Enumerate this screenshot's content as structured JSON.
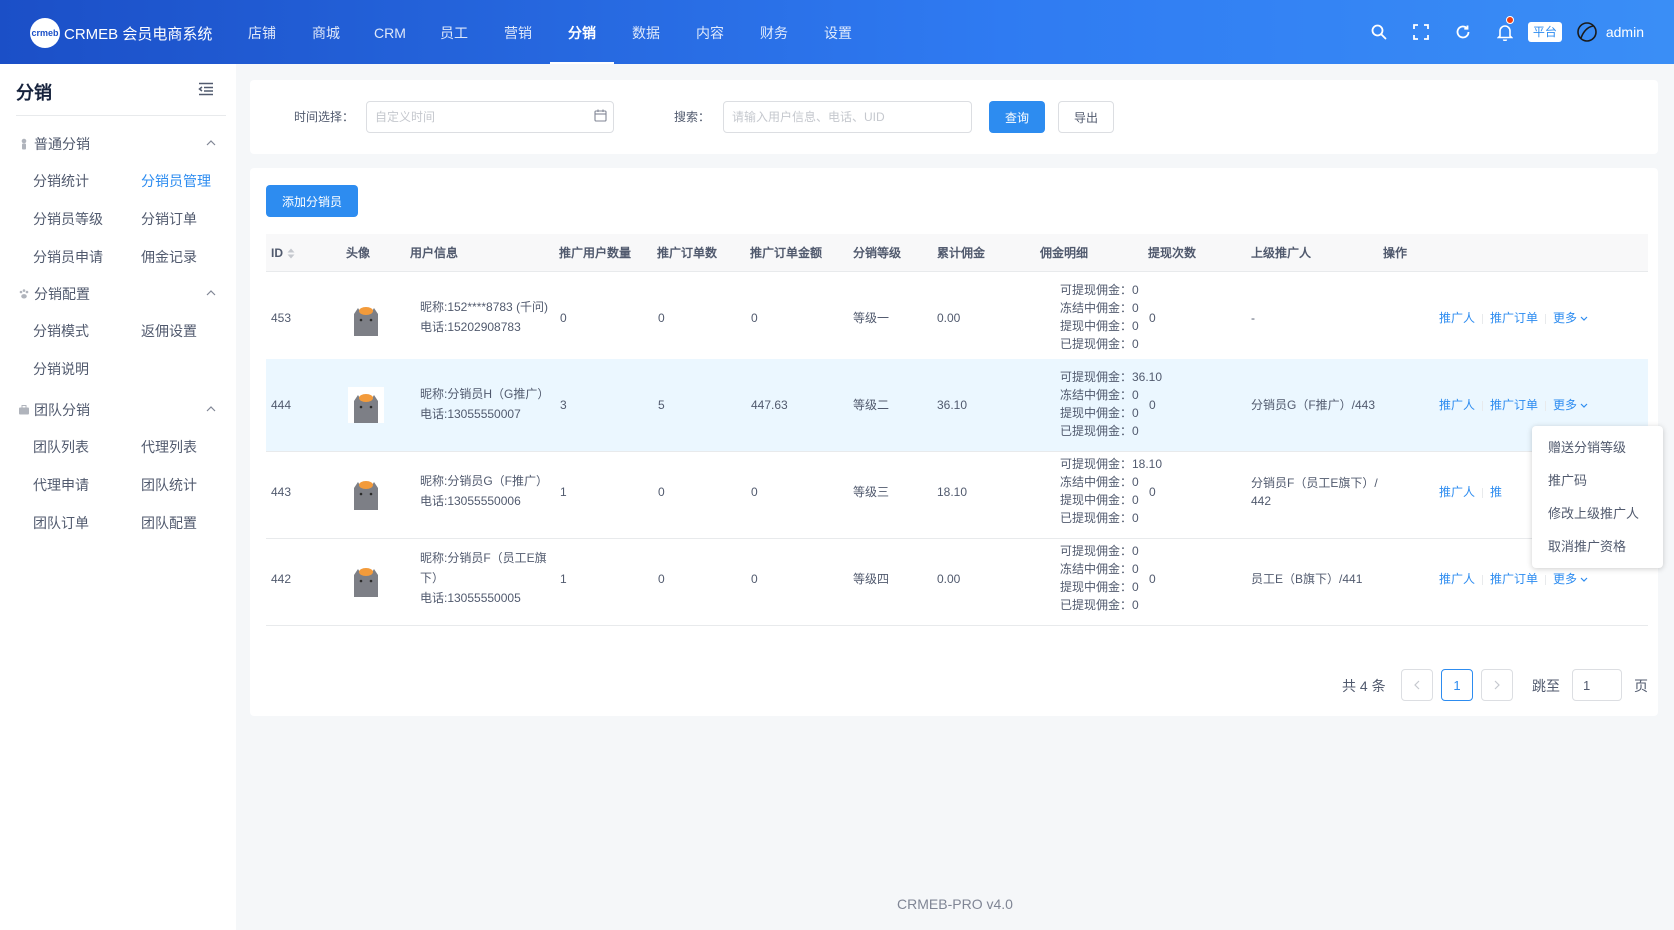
{
  "header": {
    "logo_mark": "crmeb",
    "app_name": "CRMEB 会员电商系统",
    "nav": [
      "店铺",
      "商城",
      "CRM",
      "员工",
      "营销",
      "分销",
      "数据",
      "内容",
      "财务",
      "设置"
    ],
    "active_nav": "分销",
    "platform_badge": "平台",
    "username": "admin",
    "icons": [
      "search-icon",
      "fullscreen-icon",
      "refresh-icon",
      "bell-icon",
      "avatar-icon"
    ]
  },
  "sidebar": {
    "title": "分销",
    "groups": [
      {
        "title": "普通分销",
        "icon": "user-icon",
        "items": [
          "分销统计",
          "分销员管理",
          "分销员等级",
          "分销订单",
          "分销员申请",
          "佣金记录"
        ],
        "active": "分销员管理"
      },
      {
        "title": "分销配置",
        "icon": "paw-icon",
        "items": [
          "分销模式",
          "返佣设置",
          "分销说明"
        ]
      },
      {
        "title": "团队分销",
        "icon": "briefcase-icon",
        "items": [
          "团队列表",
          "代理列表",
          "代理申请",
          "团队统计",
          "团队订单",
          "团队配置"
        ]
      }
    ]
  },
  "filter": {
    "time_label": "时间选择：",
    "time_placeholder": "自定义时间",
    "search_label": "搜索：",
    "search_placeholder": "请输入用户信息、电话、UID",
    "query_button": "查询",
    "export_button": "导出"
  },
  "table": {
    "add_button": "添加分销员",
    "columns": [
      "ID",
      "头像",
      "用户信息",
      "推广用户数量",
      "推广订单数",
      "推广订单金额",
      "分销等级",
      "累计佣金",
      "佣金明细",
      "提现次数",
      "上级推广人",
      "操作"
    ],
    "rows": [
      {
        "id": "453",
        "nickname": "昵称:152****8783 (千问)",
        "phone": "电话:15202908783",
        "promo_users": "0",
        "promo_orders": "0",
        "promo_amount": "0",
        "level": "等级一",
        "total_commission": "0.00",
        "detail": [
          "可提现佣金：0",
          "冻结中佣金：0",
          "提现中佣金：0",
          "已提现佣金：0"
        ],
        "withdraw_count": "0",
        "superior": "-"
      },
      {
        "id": "444",
        "nickname": "昵称:分销员H（G推广）",
        "phone": "电话:13055550007",
        "promo_users": "3",
        "promo_orders": "5",
        "promo_amount": "447.63",
        "level": "等级二",
        "total_commission": "36.10",
        "detail": [
          "可提现佣金：36.10",
          "冻结中佣金：0",
          "提现中佣金：0",
          "已提现佣金：0"
        ],
        "withdraw_count": "0",
        "superior": "分销员G（F推广）/443"
      },
      {
        "id": "443",
        "nickname": "昵称:分销员G（F推广）",
        "phone": "电话:13055550006",
        "promo_users": "1",
        "promo_orders": "0",
        "promo_amount": "0",
        "level": "等级三",
        "total_commission": "18.10",
        "detail": [
          "可提现佣金：18.10",
          "冻结中佣金：0",
          "提现中佣金：0",
          "已提现佣金：0"
        ],
        "withdraw_count": "0",
        "superior": "分销员F（员工E旗下）/ 442"
      },
      {
        "id": "442",
        "nickname": "昵称:分销员F（员工E旗下）",
        "phone": "电话:13055550005",
        "promo_users": "1",
        "promo_orders": "0",
        "promo_amount": "0",
        "level": "等级四",
        "total_commission": "0.00",
        "detail": [
          "可提现佣金：0",
          "冻结中佣金：0",
          "提现中佣金：0",
          "已提现佣金：0"
        ],
        "withdraw_count": "0",
        "superior": "员工E（B旗下）/441"
      }
    ],
    "op_promoter": "推广人",
    "op_orders": "推广订单",
    "op_more": "更多",
    "op_orders_partial": "推"
  },
  "dropdown": {
    "items": [
      "赠送分销等级",
      "推广码",
      "修改上级推广人",
      "取消推广资格"
    ]
  },
  "pagination": {
    "total": "共 4 条",
    "current_page": "1",
    "jump_label": "跳至",
    "jump_value": "1",
    "page_suffix": "页"
  },
  "footer": "CRMEB-PRO v4.0",
  "colors": {
    "primary": "#2d8cf0",
    "header_start": "#1b4fc7",
    "header_end": "#3a8ef6"
  }
}
